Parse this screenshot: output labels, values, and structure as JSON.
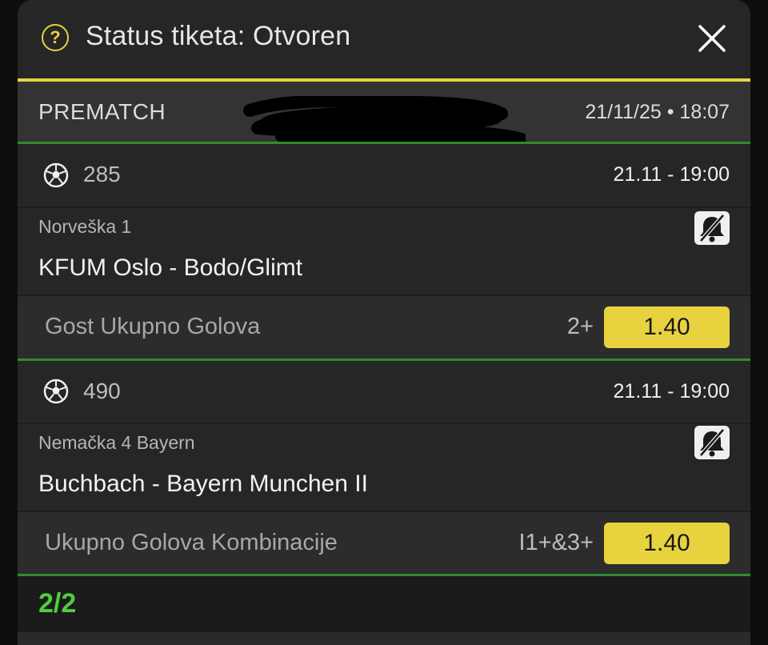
{
  "header": {
    "title": "Status tiketa: Otvoren",
    "help_icon": "?",
    "close_icon": "close-icon"
  },
  "prematch": {
    "label": "PREMATCH",
    "datetime": "21/11/25 • 18:07"
  },
  "events": [
    {
      "id": "285",
      "time": "21.11  -  19:00",
      "league": "Norveška 1",
      "match": "KFUM Oslo - Bodo/Glimt",
      "market": "Gost Ukupno Golova",
      "pick": "2+",
      "odds": "1.40"
    },
    {
      "id": "490",
      "time": "21.11  -  19:00",
      "league": "Nemačka 4 Bayern",
      "match": "Buchbach - Bayern Munchen II",
      "market": "Ukupno Golova Kombinacije",
      "pick": "I1+&3+",
      "odds": "1.40"
    }
  ],
  "footer": {
    "count": "2/2"
  },
  "colors": {
    "accent": "#e8d33f",
    "success": "#4fce3c",
    "divider_green": "#2f8a2f"
  }
}
